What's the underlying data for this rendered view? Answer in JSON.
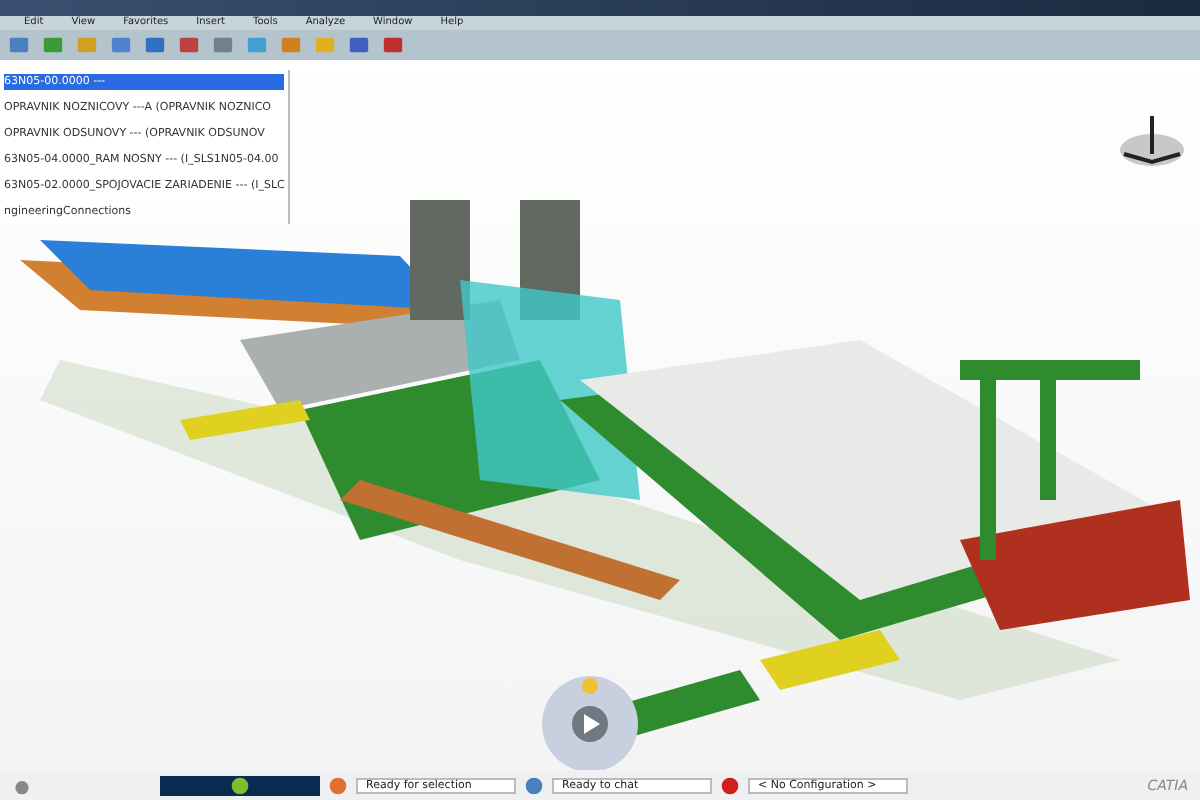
{
  "menu": [
    "Edit",
    "View",
    "Favorites",
    "Insert",
    "Tools",
    "Analyze",
    "Window",
    "Help"
  ],
  "tree": [
    {
      "label": "63N05-00.0000 ---",
      "selected": true
    },
    {
      "label": "OPRAVNIK NOZNICOVY ---A (OPRAVNIK NOZNICO",
      "selected": false
    },
    {
      "label": "OPRAVNIK ODSUNOVY --- (OPRAVNIK ODSUNOV",
      "selected": false
    },
    {
      "label": "63N05-04.0000_RAM NOSNY --- (I_SLS1N05-04.00",
      "selected": false
    },
    {
      "label": "63N05-02.0000_SPOJOVACIE ZARIADENIE --- (I_SLC",
      "selected": false
    },
    {
      "label": "ngineeringConnections",
      "selected": false
    }
  ],
  "status_bar": {
    "fields": [
      "Ready for selection",
      "Ready to chat",
      "< No Configuration >"
    ],
    "logo": "CATIA"
  }
}
